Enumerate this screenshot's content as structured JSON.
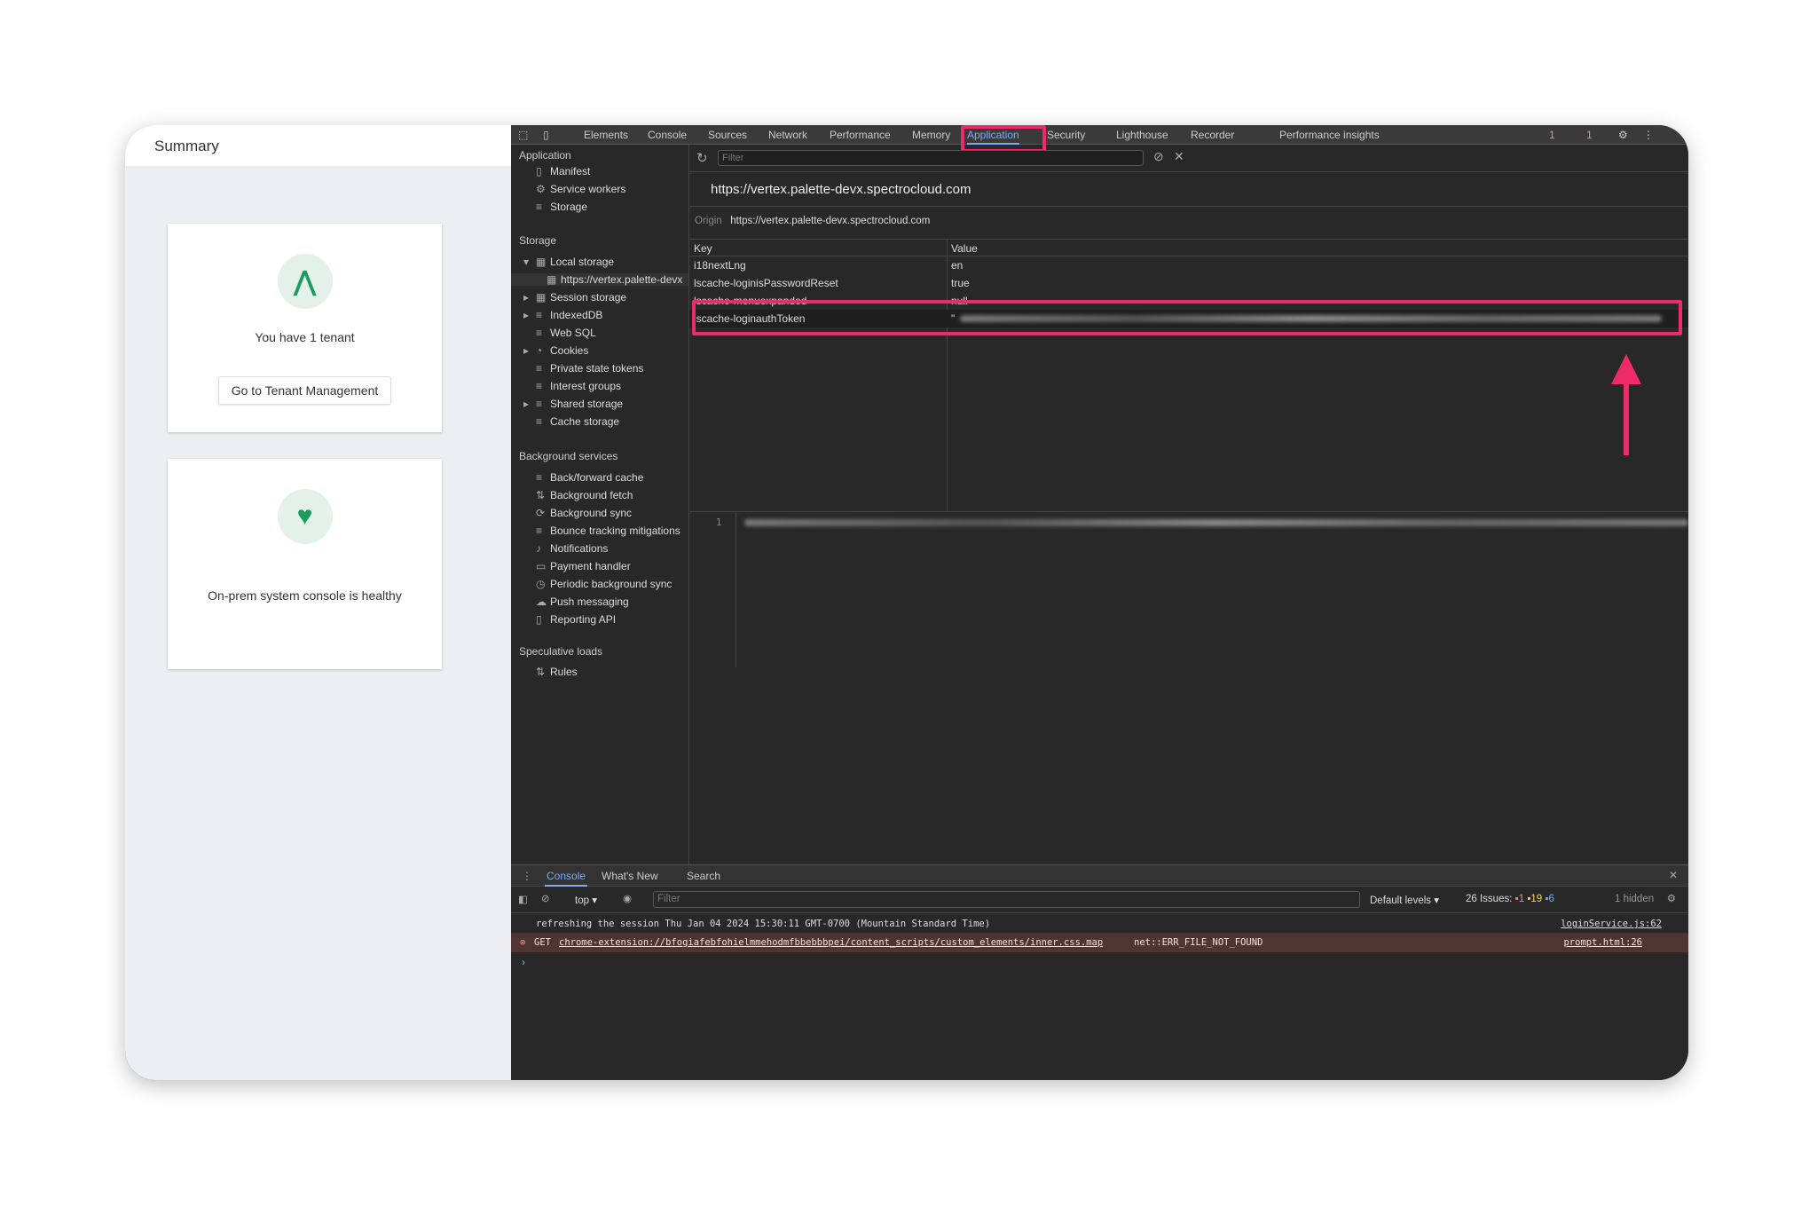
{
  "app": {
    "summary_title": "Summary",
    "tenant_card": {
      "icon": "palette-logo-icon",
      "text": "You have 1 tenant",
      "button": "Go to Tenant Management"
    },
    "health_card": {
      "icon": "heart-pulse-icon",
      "text": "On-prem system console is healthy"
    }
  },
  "devtools": {
    "tabs": [
      "Elements",
      "Console",
      "Sources",
      "Network",
      "Performance",
      "Memory",
      "Application",
      "Security",
      "Lighthouse",
      "Recorder",
      "Performance insights"
    ],
    "active_tab": "Application",
    "errors": "1",
    "warnings": "1",
    "filter_placeholder": "Filter",
    "sidebar": {
      "application_heading": "Application",
      "application_items": [
        "Manifest",
        "Service workers",
        "Storage"
      ],
      "storage_heading": "Storage",
      "storage_items": [
        "Local storage",
        "https://vertex.palette-devx",
        "Session storage",
        "IndexedDB",
        "Web SQL",
        "Cookies",
        "Private state tokens",
        "Interest groups",
        "Shared storage",
        "Cache storage"
      ],
      "background_heading": "Background services",
      "background_items": [
        "Back/forward cache",
        "Background fetch",
        "Background sync",
        "Bounce tracking mitigations",
        "Notifications",
        "Payment handler",
        "Periodic background sync",
        "Push messaging",
        "Reporting API"
      ],
      "speculative_heading": "Speculative loads",
      "speculative_items": [
        "Rules"
      ]
    },
    "storage_view": {
      "title": "https://vertex.palette-devx.spectrocloud.com",
      "origin_label": "Origin",
      "origin": "https://vertex.palette-devx.spectrocloud.com",
      "columns": [
        "Key",
        "Value"
      ],
      "rows": [
        {
          "key": "i18nextLng",
          "value": "en"
        },
        {
          "key": "lscache-loginisPasswordReset",
          "value": "true"
        },
        {
          "key": "lscache-menuexpanded",
          "value": "null"
        },
        {
          "key": "lscache-loginauthToken",
          "value": "\""
        }
      ],
      "preview_line": "1"
    },
    "drawer": {
      "tabs": [
        "Console",
        "What's New",
        "Search"
      ],
      "context": "top",
      "filter_placeholder": "Filter",
      "levels": "Default levels ▾",
      "issues_label": "26 Issues:",
      "issues_errors": "1",
      "issues_warnings": "19",
      "issues_info": "6",
      "hidden": "1 hidden",
      "logs": [
        {
          "text": "refreshing the session Thu Jan 04 2024 15:30:11 GMT-0700 (Mountain Standard Time)",
          "source": "loginService.js:62"
        },
        {
          "method": "GET",
          "url": "chrome-extension://bfogiafebfohielmmehodmfbbebbbpei/content_scripts/custom_elements/inner.css.map",
          "error": "net::ERR_FILE_NOT_FOUND",
          "source": "prompt.html:26"
        }
      ],
      "prompt": "›"
    }
  },
  "colors": {
    "highlight": "#ee2a6b",
    "accent": "#7cacf8",
    "success": "#1e9a5c"
  }
}
